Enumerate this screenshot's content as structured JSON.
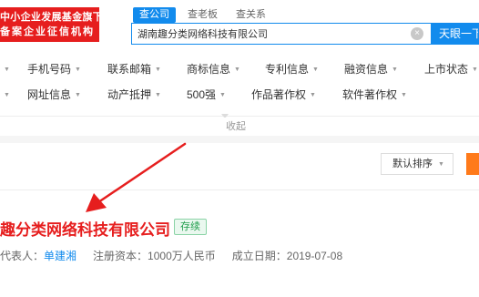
{
  "badge": {
    "line1": "中小企业发展基金旗下",
    "line2": "备案企业征信机构"
  },
  "tabs": [
    {
      "label": "查公司",
      "active": true
    },
    {
      "label": "查老板",
      "active": false
    },
    {
      "label": "查关系",
      "active": false
    }
  ],
  "search": {
    "value": "湖南趣分类网络科技有限公司",
    "button_label": "天眼一下"
  },
  "filters": {
    "row1": [
      "手机号码",
      "联系邮箱",
      "商标信息",
      "专利信息",
      "融资信息",
      "上市状态"
    ],
    "row2": [
      "网址信息",
      "动产抵押",
      "500强",
      "作品著作权",
      "软件著作权"
    ]
  },
  "collapse_label": "收起",
  "sort": {
    "label": "默认排序"
  },
  "company": {
    "name": "趣分类网络科技有限公司",
    "status": "存续",
    "rep_label": "代表人：",
    "rep_name": "单建湘",
    "capital_label": "注册资本：",
    "capital_value": "1000万人民币",
    "date_label": "成立日期：",
    "date_value": "2019-07-08"
  },
  "colors": {
    "brand_blue": "#128bed",
    "accent_red": "#e61e1e",
    "status_green": "#1f9d4b"
  }
}
